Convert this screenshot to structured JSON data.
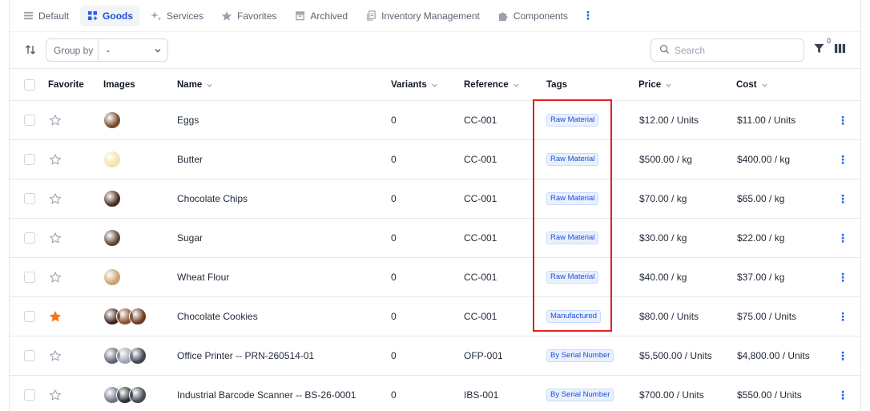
{
  "tabs": [
    {
      "label": "Default",
      "icon": "list-icon",
      "active": false
    },
    {
      "label": "Goods",
      "icon": "grid-plus-icon",
      "active": true
    },
    {
      "label": "Services",
      "icon": "sparkles-icon",
      "active": false
    },
    {
      "label": "Favorites",
      "icon": "star-icon",
      "active": false
    },
    {
      "label": "Archived",
      "icon": "archive-icon",
      "active": false
    },
    {
      "label": "Inventory Management",
      "icon": "copy-icon",
      "active": false
    },
    {
      "label": "Components",
      "icon": "puzzle-icon",
      "active": false
    }
  ],
  "tabs_more": "⋮",
  "toolbar": {
    "group_by_label": "Group by",
    "group_by_value": "-",
    "search_placeholder": "Search",
    "filter_count": "0"
  },
  "columns": {
    "favorite": "Favorite",
    "images": "Images",
    "name": "Name",
    "variants": "Variants",
    "reference": "Reference",
    "tags": "Tags",
    "price": "Price",
    "cost": "Cost"
  },
  "rows": [
    {
      "name": "Eggs",
      "variants": "0",
      "reference": "CC-001",
      "tag": "Raw Material",
      "price": "$12.00 / Units",
      "cost": "$11.00 / Units",
      "favorite": false,
      "images": [
        "#7a4a2a"
      ]
    },
    {
      "name": "Butter",
      "variants": "0",
      "reference": "CC-001",
      "tag": "Raw Material",
      "price": "$500.00 / kg",
      "cost": "$400.00 / kg",
      "favorite": false,
      "images": [
        "#f2e3a6"
      ]
    },
    {
      "name": "Chocolate Chips",
      "variants": "0",
      "reference": "CC-001",
      "tag": "Raw Material",
      "price": "$70.00 / kg",
      "cost": "$65.00 / kg",
      "favorite": false,
      "images": [
        "#4a2c1c"
      ]
    },
    {
      "name": "Sugar",
      "variants": "0",
      "reference": "CC-001",
      "tag": "Raw Material",
      "price": "$30.00 / kg",
      "cost": "$22.00 / kg",
      "favorite": false,
      "images": [
        "#5a4536"
      ]
    },
    {
      "name": "Wheat Flour",
      "variants": "0",
      "reference": "CC-001",
      "tag": "Raw Material",
      "price": "$40.00 / kg",
      "cost": "$37.00 / kg",
      "favorite": false,
      "images": [
        "#c9a36a"
      ]
    },
    {
      "name": "Chocolate Cookies",
      "variants": "0",
      "reference": "CC-001",
      "tag": "Manufactured",
      "price": "$80.00 / Units",
      "cost": "$75.00 / Units",
      "favorite": true,
      "images": [
        "#3b2418",
        "#8b4d2c",
        "#6b3a22"
      ]
    },
    {
      "name": "Office Printer -- PRN-260514-01",
      "variants": "0",
      "reference": "OFP-001",
      "tag": "By Serial Number",
      "price": "$5,500.00 / Units",
      "cost": "$4,800.00 / Units",
      "favorite": false,
      "images": [
        "#5b6470",
        "#9aa4b0",
        "#3d4550"
      ]
    },
    {
      "name": "Industrial Barcode Scanner -- BS-26-0001",
      "variants": "0",
      "reference": "IBS-001",
      "tag": "By Serial Number",
      "price": "$700.00 / Units",
      "cost": "$550.00 / Units",
      "favorite": false,
      "images": [
        "#6b7785",
        "#2c2f34",
        "#444a52"
      ]
    }
  ],
  "row_actions_icon": "⋮",
  "colors": {
    "accent": "#2563eb",
    "favorite_star": "#f97316",
    "highlight": "#e11d24"
  }
}
